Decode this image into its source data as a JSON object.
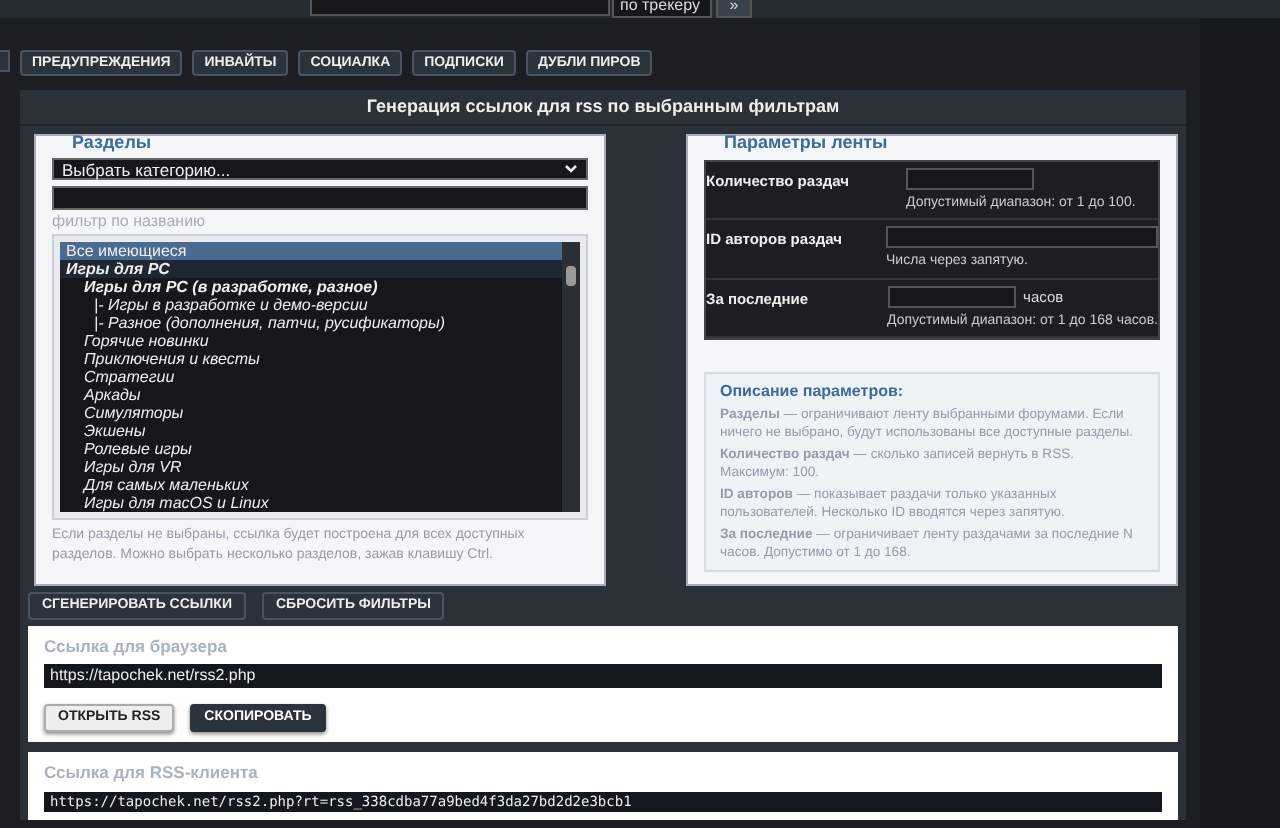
{
  "top_bar": {
    "scope_select": "по трекеру",
    "go_button": "»"
  },
  "tabs": [
    {
      "label": "ПРЕДУПРЕЖДЕНИЯ",
      "selected": false
    },
    {
      "label": "ИНВАЙТЫ",
      "selected": false
    },
    {
      "label": "СОЦИАЛКА",
      "selected": false
    },
    {
      "label": "ПОДПИСКИ",
      "selected": false
    },
    {
      "label": "ДУБЛИ ПИРОВ",
      "selected": false
    }
  ],
  "panel": {
    "title": "Генерация ссылок для rss по выбранным фильтрам"
  },
  "sections": {
    "legend": "Разделы",
    "category_select": "Выбрать категорию...",
    "filter_hint": "фильтр по названию",
    "items": [
      {
        "label": "Все имеющиеся",
        "kind": "all",
        "selected": true
      },
      {
        "label": "Игры для PC",
        "kind": "category",
        "selected": false,
        "children": [
          {
            "label": "Игры для PC (в разработке, разное)",
            "kind": "group",
            "selected": false,
            "children": [
              {
                "label": "|- Игры в разработке и демо-версии",
                "kind": "forum",
                "selected": false
              },
              {
                "label": "|- Разное (дополнения, патчи, русификаторы)",
                "kind": "forum",
                "selected": false
              }
            ]
          },
          {
            "label": "Горячие новинки",
            "kind": "forum",
            "selected": false
          },
          {
            "label": "Приключения и квесты",
            "kind": "forum",
            "selected": false
          },
          {
            "label": "Стратегии",
            "kind": "forum",
            "selected": false
          },
          {
            "label": "Аркады",
            "kind": "forum",
            "selected": false
          },
          {
            "label": "Симуляторы",
            "kind": "forum",
            "selected": false
          },
          {
            "label": "Экшены",
            "kind": "forum",
            "selected": false
          },
          {
            "label": "Ролевые игры",
            "kind": "forum",
            "selected": false
          },
          {
            "label": "Игры для VR",
            "kind": "forum",
            "selected": false
          },
          {
            "label": "Для самых маленьких",
            "kind": "forum",
            "selected": false
          },
          {
            "label": "Игры для macOS и Linux",
            "kind": "forum",
            "selected": false
          }
        ]
      }
    ],
    "note": "Если разделы не выбраны, ссылка будет построена для всех доступных разделов. Можно выбрать несколько разделов, зажав клавишу Ctrl."
  },
  "params": {
    "legend": "Параметры ленты",
    "rows": [
      {
        "label": "Количество раздач",
        "kind": "short",
        "hint": "Допустимый диапазон: от 1 до 100."
      },
      {
        "label": "ID авторов раздач",
        "kind": "wide",
        "hint": "Числа через запятую."
      },
      {
        "label": "За последние",
        "kind": "short",
        "unit": "часов",
        "hint": "Допустимый диапазон: от 1 до 168 часов."
      }
    ],
    "description": {
      "title": "Описание параметров:",
      "paragraphs": [
        "**Разделы** — ограничивают ленту выбранными форумами. Если ничего не выбрано, будут использованы все доступные разделы.",
        "**Количество раздач** — сколько записей вернуть в RSS. Максимум: 100.",
        "**ID авторов** — показывает раздачи только указанных пользователей. Несколько ID вводятся через запятую.",
        "**За последние** — ограничивает ленту раздачами за последние N часов. Допустимо от 1 до 168."
      ]
    }
  },
  "actions": [
    "СГЕНЕРИРОВАТЬ ССЫЛКИ",
    "СБРОСИТЬ ФИЛЬТРЫ"
  ],
  "browser_link": {
    "label": "Ссылка для браузера",
    "url": "https://tapochek.net/rss2.php",
    "buttons": [
      {
        "label": "ОТКРЫТЬ RSS",
        "kind": "light"
      },
      {
        "label": "СКОПИРОВАТЬ",
        "kind": "dark"
      }
    ]
  },
  "client_link": {
    "label": "Ссылка для RSS-клиента",
    "url": "https://tapochek.net/rss2.php?rt=rss_338cdba77a9bed4f3da27bd2d2e3bcb1"
  }
}
